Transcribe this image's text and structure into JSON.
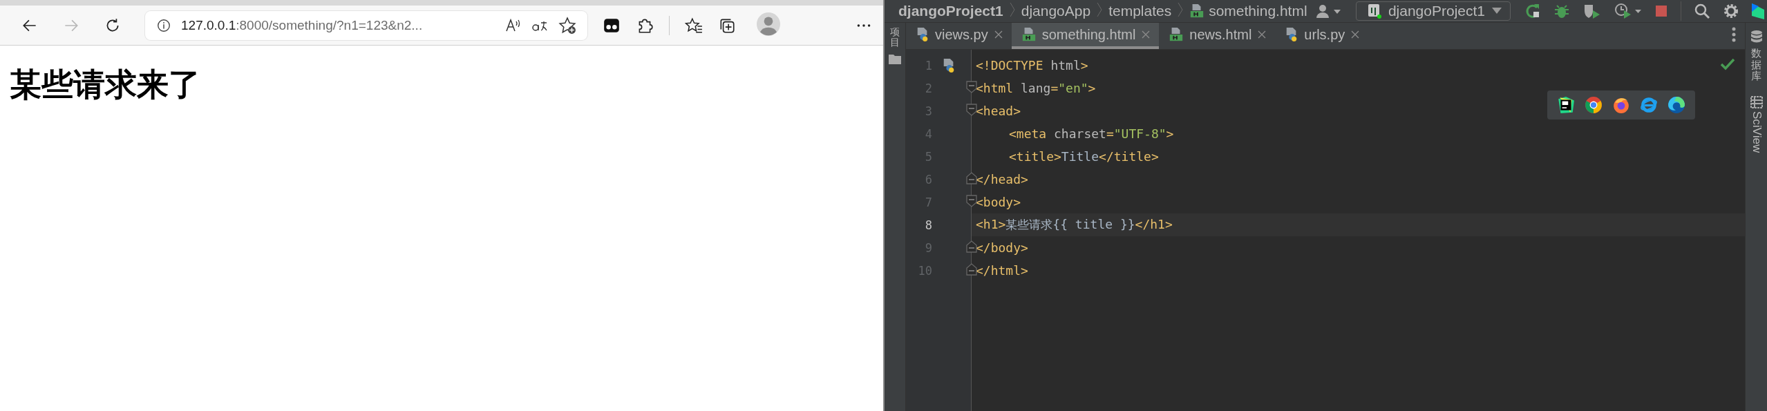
{
  "browser": {
    "nav": [
      {
        "kind": "back",
        "disabled": false
      },
      {
        "kind": "forward",
        "disabled": true
      },
      {
        "kind": "refresh",
        "disabled": false
      }
    ],
    "address": {
      "host": "127.0.0.1",
      "rest": ":8000/something/?n1=123&n2..."
    },
    "page_heading": "某些请求来了"
  },
  "ide": {
    "breadcrumbs": [
      {
        "label": "djangoProject1",
        "kind": "project"
      },
      {
        "label": "djangoApp",
        "kind": "folder"
      },
      {
        "label": "templates",
        "kind": "folder"
      },
      {
        "label": "something.html",
        "kind": "html"
      }
    ],
    "run_config": "djangoProject1",
    "tabs": [
      {
        "label": "views.py",
        "kind": "python",
        "selected": false
      },
      {
        "label": "something.html",
        "kind": "html",
        "selected": true
      },
      {
        "label": "news.html",
        "kind": "html",
        "selected": false
      },
      {
        "label": "urls.py",
        "kind": "python",
        "selected": false
      }
    ],
    "left_tool": "项目",
    "right_tools": [
      {
        "label": "数据库",
        "kind": "database"
      },
      {
        "label": "SciView",
        "kind": "sciview"
      }
    ],
    "lines": [
      {
        "number": "1",
        "fold_start": false,
        "fold_end": false,
        "current": false,
        "gutter_icon": true,
        "indented": false,
        "tokens": [
          {
            "kind": "tag",
            "text": "<!DOCTYPE "
          },
          {
            "kind": "attr",
            "text": "html"
          },
          {
            "kind": "tag",
            "text": ">"
          }
        ]
      },
      {
        "number": "2",
        "fold_start": true,
        "fold_end": false,
        "current": false,
        "gutter_icon": false,
        "indented": false,
        "tokens": [
          {
            "kind": "tag",
            "text": "<html "
          },
          {
            "kind": "attr",
            "text": "lang"
          },
          {
            "kind": "tag",
            "text": "="
          },
          {
            "kind": "value",
            "text": "\"en\""
          },
          {
            "kind": "tag",
            "text": ">"
          }
        ]
      },
      {
        "number": "3",
        "fold_start": true,
        "fold_end": false,
        "current": false,
        "gutter_icon": false,
        "indented": false,
        "tokens": [
          {
            "kind": "tag",
            "text": "<head>"
          }
        ]
      },
      {
        "number": "4",
        "fold_start": false,
        "fold_end": false,
        "current": false,
        "gutter_icon": false,
        "indented": true,
        "tokens": [
          {
            "kind": "tag",
            "text": "<meta "
          },
          {
            "kind": "attr",
            "text": "charset"
          },
          {
            "kind": "tag",
            "text": "="
          },
          {
            "kind": "value",
            "text": "\"UTF-8\""
          },
          {
            "kind": "tag",
            "text": ">"
          }
        ]
      },
      {
        "number": "5",
        "fold_start": false,
        "fold_end": false,
        "current": false,
        "gutter_icon": false,
        "indented": true,
        "tokens": [
          {
            "kind": "tag",
            "text": "<title>"
          },
          {
            "kind": "text",
            "text": "Title"
          },
          {
            "kind": "tag",
            "text": "</title>"
          }
        ]
      },
      {
        "number": "6",
        "fold_start": false,
        "fold_end": true,
        "current": false,
        "gutter_icon": false,
        "indented": false,
        "tokens": [
          {
            "kind": "tag",
            "text": "</head>"
          }
        ]
      },
      {
        "number": "7",
        "fold_start": true,
        "fold_end": false,
        "current": false,
        "gutter_icon": false,
        "indented": false,
        "tokens": [
          {
            "kind": "tag",
            "text": "<body>"
          }
        ]
      },
      {
        "number": "8",
        "fold_start": false,
        "fold_end": false,
        "current": true,
        "gutter_icon": false,
        "indented": false,
        "tokens": [
          {
            "kind": "tag",
            "text": "<h1>"
          },
          {
            "kind": "cjk",
            "text": "某些请求"
          },
          {
            "kind": "text",
            "text": "{{ title }}"
          },
          {
            "kind": "tag",
            "text": "</h1>"
          }
        ]
      },
      {
        "number": "9",
        "fold_start": false,
        "fold_end": true,
        "current": false,
        "gutter_icon": false,
        "indented": false,
        "tokens": [
          {
            "kind": "tag",
            "text": "</body>"
          }
        ]
      },
      {
        "number": "10",
        "fold_start": false,
        "fold_end": true,
        "current": false,
        "gutter_icon": false,
        "indented": false,
        "tokens": [
          {
            "kind": "tag",
            "text": "</html>"
          }
        ]
      }
    ],
    "browser_popup": [
      {
        "kind": "pycharm"
      },
      {
        "kind": "chrome"
      },
      {
        "kind": "firefox"
      },
      {
        "kind": "ie"
      },
      {
        "kind": "edge"
      }
    ]
  }
}
